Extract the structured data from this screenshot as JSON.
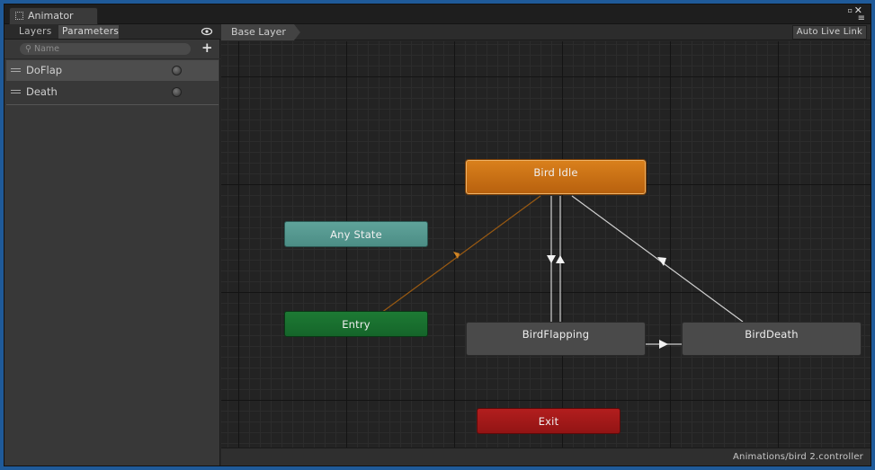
{
  "window": {
    "tab_title": "Animator"
  },
  "left_panel": {
    "tabs": {
      "layers": "Layers",
      "parameters": "Parameters"
    },
    "search_placeholder": "Name",
    "add_label": "+",
    "parameters": [
      {
        "name": "DoFlap",
        "selected": true
      },
      {
        "name": "Death",
        "selected": false
      }
    ]
  },
  "graph": {
    "breadcrumb": "Base Layer",
    "auto_live_link": "Auto Live Link",
    "states": {
      "idle": "Bird Idle",
      "any": "Any State",
      "entry": "Entry",
      "flapping": "BirdFlapping",
      "death": "BirdDeath",
      "exit": "Exit"
    },
    "colors": {
      "default_state": "#d9801c",
      "any_state": "#5fa39a",
      "entry": "#1d7a34",
      "exit": "#b21e1e",
      "normal_state": "#4a4a4a"
    }
  },
  "status_bar": {
    "path": "Animations/bird 2.controller"
  }
}
